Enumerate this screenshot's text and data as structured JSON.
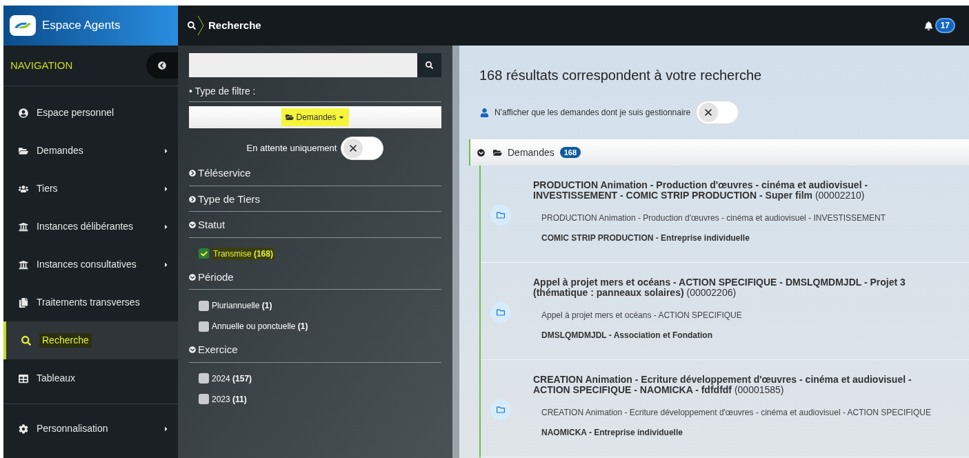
{
  "header": {
    "app_name": "Espace Agents",
    "page_title": "Recherche",
    "notifications": "17"
  },
  "sidebar": {
    "heading": "NAVIGATION",
    "items": [
      {
        "label": "Espace personnel",
        "kind": "user",
        "submenu": false,
        "selected": false
      },
      {
        "label": "Demandes",
        "kind": "folder",
        "submenu": true,
        "selected": false
      },
      {
        "label": "Tiers",
        "kind": "users",
        "submenu": true,
        "selected": false
      },
      {
        "label": "Instances délibérantes",
        "kind": "bank",
        "submenu": true,
        "selected": false
      },
      {
        "label": "Instances consultatives",
        "kind": "bank",
        "submenu": true,
        "selected": false
      },
      {
        "label": "Traitements transverses",
        "kind": "copy",
        "submenu": false,
        "selected": false
      },
      {
        "label": "Recherche",
        "kind": "search",
        "submenu": false,
        "selected": true
      },
      {
        "label": "Tableaux",
        "kind": "table",
        "submenu": false,
        "selected": false
      }
    ],
    "footer_item": {
      "label": "Personnalisation",
      "kind": "gear",
      "submenu": true,
      "selected": false
    }
  },
  "filters": {
    "filter_type_bullet": "•",
    "filter_type_label": "Type de filtre :",
    "filter_type_value": "Demandes",
    "filter_type_highlighted": true,
    "pending_only": {
      "label": "En attente uniquement",
      "on": false
    },
    "sections": [
      {
        "title": "Téléservice",
        "expanded": false
      },
      {
        "title": "Type de Tiers",
        "expanded": false
      },
      {
        "title": "Statut",
        "expanded": true,
        "options": [
          {
            "label": "Transmise **(168)**",
            "checked": true,
            "highlighted": true
          }
        ]
      },
      {
        "title": "Période",
        "expanded": true,
        "options": [
          {
            "label": "Pluriannuelle **(1)**",
            "checked": false,
            "highlighted": false
          },
          {
            "label": "Annuelle ou ponctuelle **(1)**",
            "checked": false,
            "highlighted": false
          }
        ]
      },
      {
        "title": "Exercice",
        "expanded": true,
        "options": [
          {
            "label": "2024 **(157)**",
            "checked": false,
            "highlighted": false
          },
          {
            "label": "2023 **(11)**",
            "checked": false,
            "highlighted": false
          }
        ]
      }
    ]
  },
  "results": {
    "title": "168 résultats correspondent à votre recherche",
    "manager_only": {
      "label": "N'afficher que les demandes dont je suis gestionnaire",
      "on": false
    },
    "group": {
      "label": "Demandes",
      "count": "168",
      "expanded": true
    },
    "items": [
      {
        "title": "**PRODUCTION Animation - Production d'œuvres - cinéma et audiovisuel - INVESTISSEMENT - COMIC STRIP PRODUCTION - Super film** (00002210)",
        "subtitle": "PRODUCTION Animation - Production d'œuvres - cinéma et audiovisuel - INVESTISSEMENT",
        "applicant": "COMIC STRIP PRODUCTION - Entreprise individuelle"
      },
      {
        "title": "**Appel à projet mers et océans - ACTION SPECIFIQUE - DMSLQMDMJDL - Projet 3 (thématique : panneaux solaires)** (00002206)",
        "subtitle": "Appel à projet mers et océans - ACTION SPECIFIQUE",
        "applicant": "DMSLQMDMJDL - Association et Fondation"
      },
      {
        "title": "**CREATION Animation - Ecriture développement d'œuvres - cinéma et audiovisuel - ACTION SPECIFIQUE - NAOMICKA - fdfdfdf** (00001585)",
        "subtitle": "CREATION Animation - Ecriture développement d'œuvres - cinéma et audiovisuel - ACTION SPECIFIQUE",
        "applicant": "NAOMICKA - Entreprise individuelle"
      }
    ]
  }
}
